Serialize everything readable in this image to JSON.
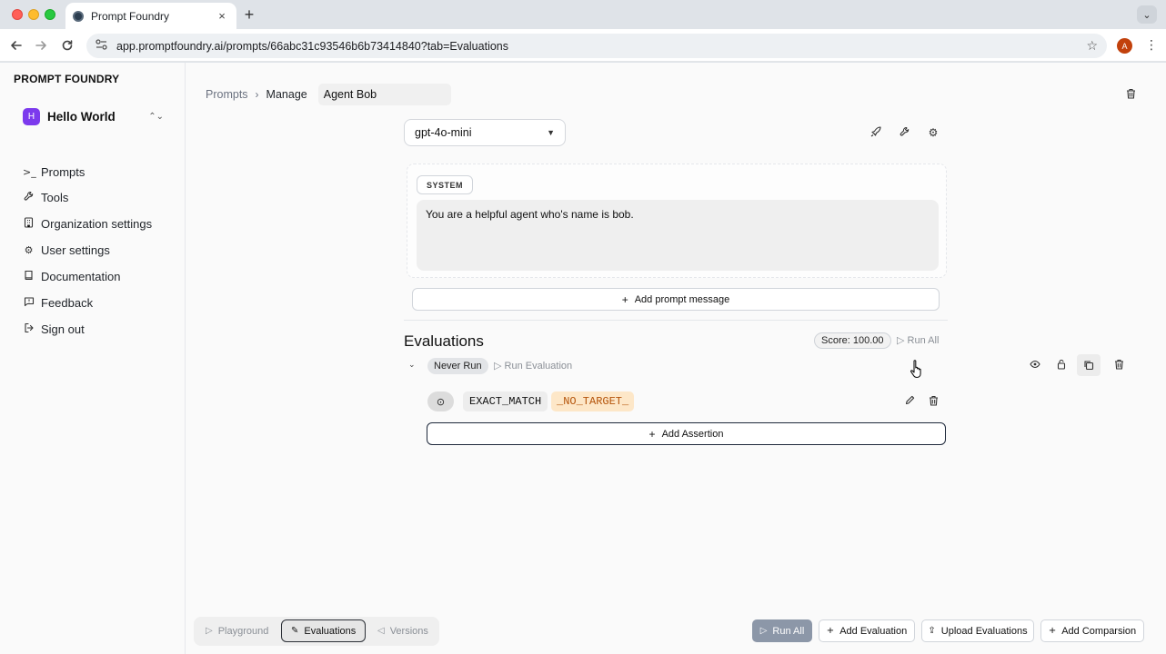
{
  "browser": {
    "tab_title": "Prompt Foundry",
    "tab_close": "×",
    "new_tab": "+",
    "tab_menu": "⌄",
    "url": "app.promptfoundry.ai/prompts/66abc31c93546b6b73414840?tab=Evaluations",
    "profile_initial": "A"
  },
  "sidebar": {
    "brand": "PROMPT FOUNDRY",
    "workspace": {
      "name": "Hello World",
      "logo": "H"
    },
    "items": [
      {
        "label": "Prompts",
        "icon": "terminal-icon"
      },
      {
        "label": "Tools",
        "icon": "wrench-icon"
      },
      {
        "label": "Organization settings",
        "icon": "building-icon"
      },
      {
        "label": "User settings",
        "icon": "gear-icon"
      },
      {
        "label": "Documentation",
        "icon": "book-icon"
      },
      {
        "label": "Feedback",
        "icon": "message-icon"
      },
      {
        "label": "Sign out",
        "icon": "sign-out-icon"
      }
    ]
  },
  "breadcrumb": {
    "prompts": "Prompts",
    "manage": "Manage",
    "name_value": "Agent Bob"
  },
  "model": {
    "selected": "gpt-4o-mini"
  },
  "message": {
    "role": "SYSTEM",
    "content": "You are a helpful agent who's name is bob."
  },
  "add_message_label": "Add prompt message",
  "evaluations": {
    "title": "Evaluations",
    "score": "Score: 100.00",
    "run_all": "Run All",
    "status": "Never Run",
    "run_evaluation": "Run Evaluation",
    "assertion": {
      "type": "EXACT_MATCH",
      "target": "_NO_TARGET_"
    },
    "add_assertion": "Add Assertion"
  },
  "bottom": {
    "tabs": [
      {
        "label": "Playground",
        "active": false
      },
      {
        "label": "Evaluations",
        "active": true
      },
      {
        "label": "Versions",
        "active": false
      }
    ],
    "run_all": "Run All",
    "add_evaluation": "Add Evaluation",
    "upload_evaluations": "Upload Evaluations",
    "add_comparison": "Add Comparsion"
  },
  "colors": {
    "accent": "#7c3aed",
    "target_text": "#b45309",
    "target_bg": "#fde7c8",
    "primary_button": "#8c97a8"
  }
}
